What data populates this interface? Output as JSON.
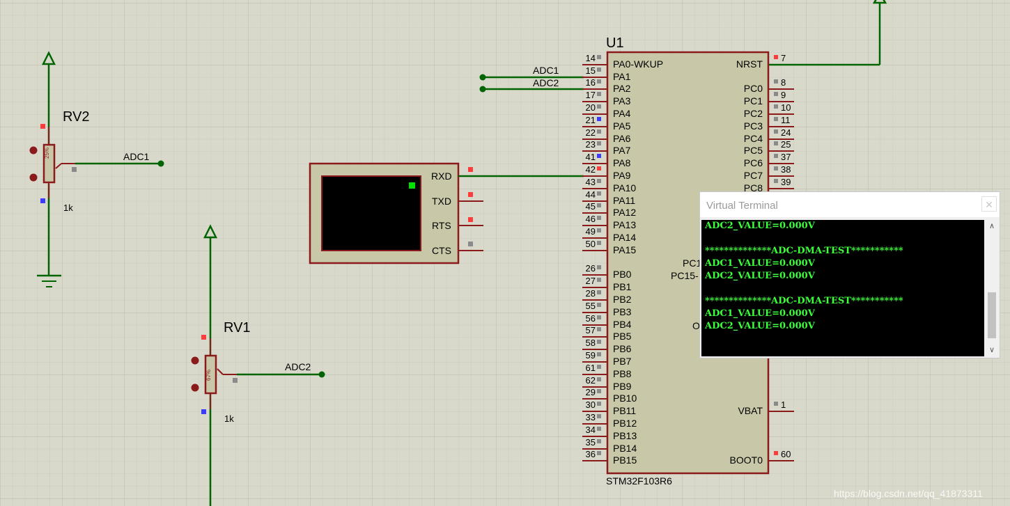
{
  "colors": {
    "background": "#d8d8cb",
    "grid_minor": "#cdcdbf",
    "grid_major": "#c2c2b4",
    "wire": "#006400",
    "component": "#8b1a1a",
    "body_fill": "#c8c8a8",
    "terminal_text": "#3cff3c"
  },
  "potentiometers": [
    {
      "ref": "RV2",
      "value": "1k",
      "wiper_pct": "25%",
      "net": "ADC1"
    },
    {
      "ref": "RV1",
      "value": "1k",
      "wiper_pct": "67%",
      "net": "ADC2"
    }
  ],
  "mcu": {
    "ref": "U1",
    "part": "STM32F103R6",
    "left_pins": [
      {
        "num": "14",
        "name": "PA0-WKUP"
      },
      {
        "num": "15",
        "name": "PA1"
      },
      {
        "num": "16",
        "name": "PA2"
      },
      {
        "num": "17",
        "name": "PA3"
      },
      {
        "num": "20",
        "name": "PA4"
      },
      {
        "num": "21",
        "name": "PA5"
      },
      {
        "num": "22",
        "name": "PA6"
      },
      {
        "num": "23",
        "name": "PA7"
      },
      {
        "num": "41",
        "name": "PA8"
      },
      {
        "num": "42",
        "name": "PA9"
      },
      {
        "num": "43",
        "name": "PA10"
      },
      {
        "num": "44",
        "name": "PA11"
      },
      {
        "num": "45",
        "name": "PA12"
      },
      {
        "num": "46",
        "name": "PA13"
      },
      {
        "num": "49",
        "name": "PA14"
      },
      {
        "num": "50",
        "name": "PA15"
      },
      {
        "num": "26",
        "name": "PB0"
      },
      {
        "num": "27",
        "name": "PB1"
      },
      {
        "num": "28",
        "name": "PB2"
      },
      {
        "num": "55",
        "name": "PB3"
      },
      {
        "num": "56",
        "name": "PB4"
      },
      {
        "num": "57",
        "name": "PB5"
      },
      {
        "num": "58",
        "name": "PB6"
      },
      {
        "num": "59",
        "name": "PB7"
      },
      {
        "num": "61",
        "name": "PB8"
      },
      {
        "num": "62",
        "name": "PB9"
      },
      {
        "num": "29",
        "name": "PB10"
      },
      {
        "num": "30",
        "name": "PB11"
      },
      {
        "num": "33",
        "name": "PB12"
      },
      {
        "num": "34",
        "name": "PB13"
      },
      {
        "num": "35",
        "name": "PB14"
      },
      {
        "num": "36",
        "name": "PB15"
      }
    ],
    "right_pins": [
      {
        "num": "7",
        "name": "NRST"
      },
      {
        "num": "8",
        "name": "PC0"
      },
      {
        "num": "9",
        "name": "PC1"
      },
      {
        "num": "10",
        "name": "PC2"
      },
      {
        "num": "11",
        "name": "PC3"
      },
      {
        "num": "24",
        "name": "PC4"
      },
      {
        "num": "25",
        "name": "PC5"
      },
      {
        "num": "37",
        "name": "PC6"
      },
      {
        "num": "38",
        "name": "PC7"
      },
      {
        "num": "39",
        "name": "PC8"
      },
      {
        "num": "1",
        "name": "VBAT"
      },
      {
        "num": "60",
        "name": "BOOT0"
      }
    ],
    "partial_labels": {
      "pc14": "PC1",
      "pc15": "PC15-",
      "osc": "O"
    }
  },
  "nets": {
    "adc1": "ADC1",
    "adc2": "ADC2"
  },
  "virtual_terminal_device": {
    "pins": [
      "RXD",
      "TXD",
      "RTS",
      "CTS"
    ]
  },
  "terminal_window": {
    "title": "Virtual Terminal",
    "close": "✕",
    "lines": [
      "ADC2_VALUE=0.000V",
      "",
      "**************ADC-DMA-TEST***********",
      "ADC1_VALUE=0.000V",
      "ADC2_VALUE=0.000V",
      "",
      "**************ADC-DMA-TEST***********",
      "ADC1_VALUE=0.000V",
      "ADC2_VALUE=0.000V"
    ],
    "scroll_up": "∧",
    "scroll_down": "∨"
  },
  "watermark": "https://blog.csdn.net/qq_41873311"
}
